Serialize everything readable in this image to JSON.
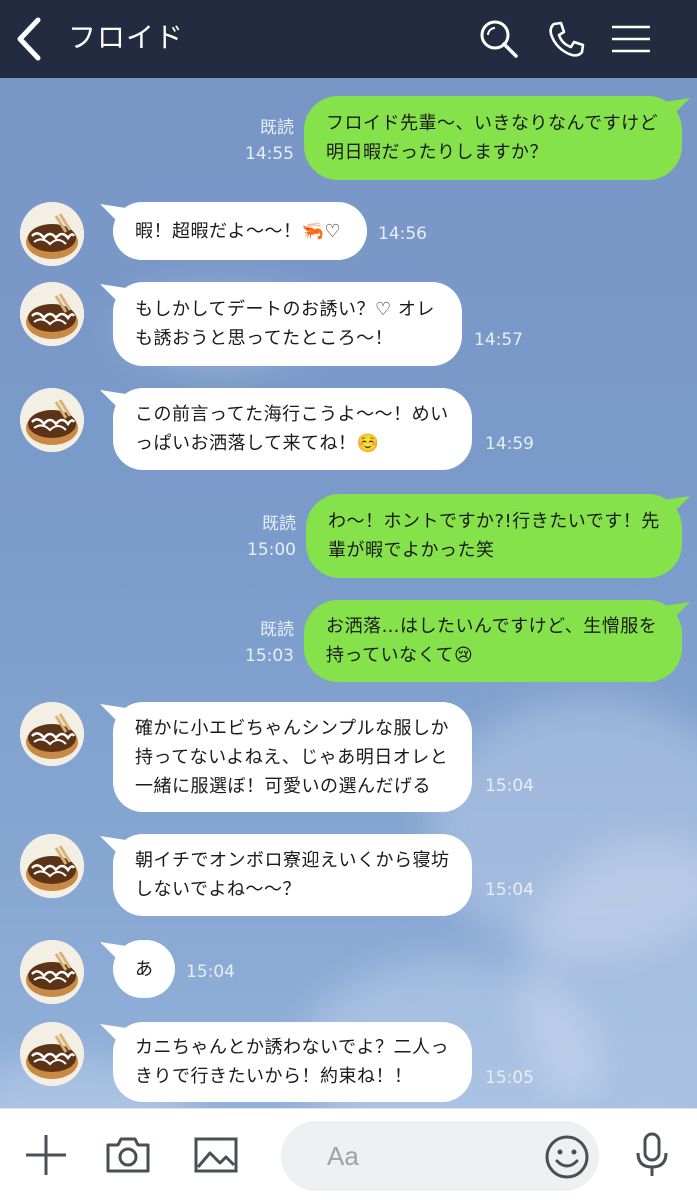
{
  "header": {
    "title": "フロイド",
    "icons": [
      "back-icon",
      "search-icon",
      "phone-icon",
      "menu-icon"
    ]
  },
  "messages": [
    {
      "side": "out",
      "read": "既読",
      "time": "14:55",
      "text": "フロイド先輩〜、いきなりなんですけど\n明日暇だったりしますか？"
    },
    {
      "side": "in",
      "time": "14:56",
      "text": "暇！超暇だよ〜〜！🦐♡"
    },
    {
      "side": "in",
      "time": "14:57",
      "text": "もしかしてデートのお誘い？♡ オレ\nも誘おうと思ってたところ〜！"
    },
    {
      "side": "in",
      "time": "14:59",
      "text": "この前言ってた海行こうよ〜〜！めい\nっぱいお洒落して来てね！☺️"
    },
    {
      "side": "out",
      "read": "既読",
      "time": "15:00",
      "text": "わ〜！ホントですか?!行きたいです！先\n輩が暇でよかった笑"
    },
    {
      "side": "out",
      "read": "既読",
      "time": "15:03",
      "text": "お洒落…はしたいんですけど、生憎服を\n持っていなくて😢"
    },
    {
      "side": "in",
      "time": "15:04",
      "text": "確かに小エビちゃんシンプルな服しか\n持ってないよねえ、じゃあ明日オレと\n一緒に服選ぼ！可愛いの選んだげる"
    },
    {
      "side": "in",
      "time": "15:04",
      "text": "朝イチでオンボロ寮迎えいくから寝坊\nしないでよね〜〜？"
    },
    {
      "side": "in",
      "time": "15:04",
      "text": "あ"
    },
    {
      "side": "in",
      "time": "15:05",
      "text": "カニちゃんとか誘わないでよ？二人っ\nきりで行きたいから！約束ね！！"
    }
  ],
  "input": {
    "placeholder": "Aa",
    "icons": [
      "plus-icon",
      "camera-icon",
      "image-icon",
      "emoji-icon",
      "mic-icon"
    ]
  }
}
